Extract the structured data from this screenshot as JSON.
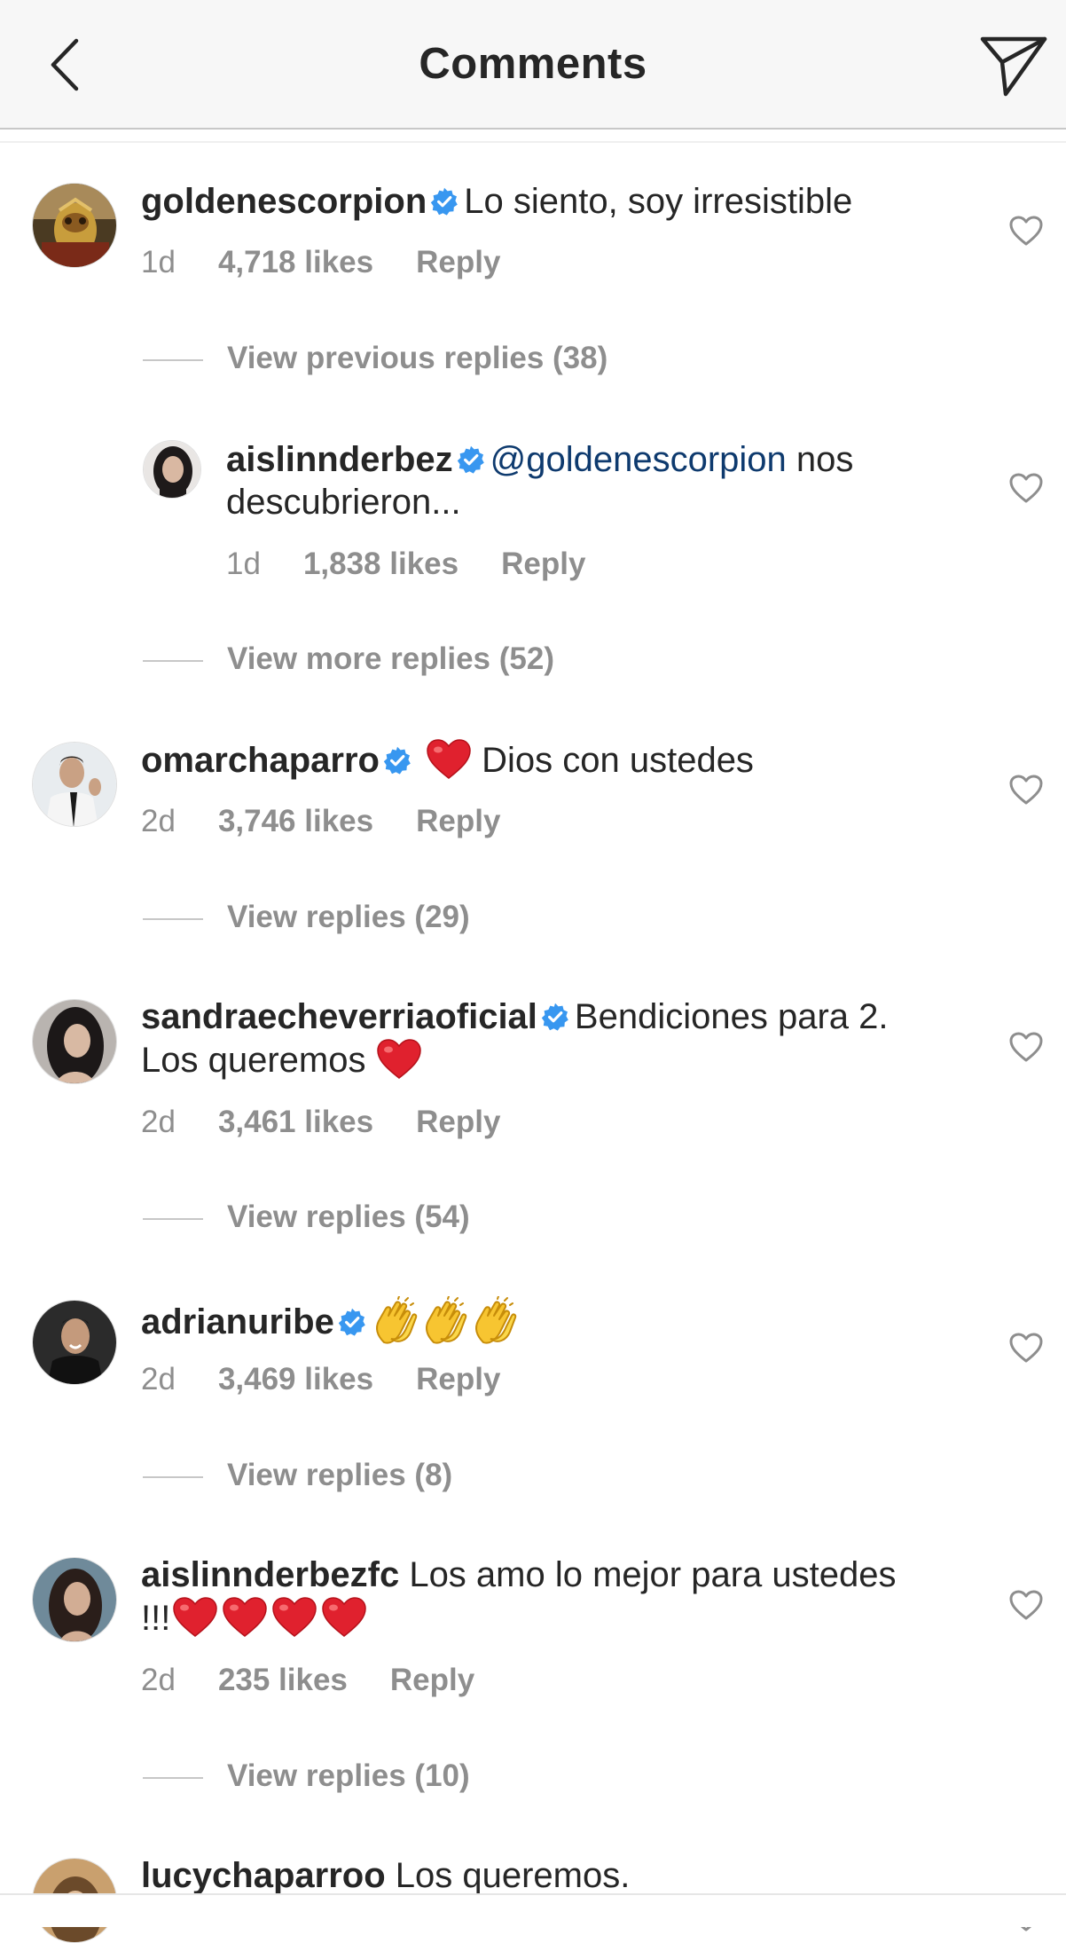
{
  "header": {
    "title": "Comments"
  },
  "comments": [
    {
      "username": "goldenescorpion",
      "verified": true,
      "text": "Lo siento, soy irresistible",
      "time": "1d",
      "likes": "4,718 likes",
      "reply": "Reply"
    },
    {
      "username": "aislinnderbez",
      "verified": true,
      "mention": "@goldenescorpion",
      "text_line1": " nos",
      "text_line2": "descubrieron...",
      "time": "1d",
      "likes": "1,838 likes",
      "reply": "Reply"
    },
    {
      "username": "omarchaparro",
      "verified": true,
      "text": " Dios con ustedes",
      "time": "2d",
      "likes": "3,746 likes",
      "reply": "Reply"
    },
    {
      "username": "sandraecheverriaoficial",
      "verified": true,
      "text_line1": "Bendiciones para 2.",
      "text_line2": "Los queremos ",
      "time": "2d",
      "likes": "3,461 likes",
      "reply": "Reply"
    },
    {
      "username": "adrianuribe",
      "verified": true,
      "time": "2d",
      "likes": "3,469 likes",
      "reply": "Reply"
    },
    {
      "username": "aislinnderbezfc",
      "verified": false,
      "text_line1": " Los amo lo mejor para ustedes",
      "text_line2": "!!!",
      "time": "2d",
      "likes": "235 likes",
      "reply": "Reply"
    },
    {
      "username": "lucychaparroo",
      "verified": false,
      "text": " Los queremos."
    }
  ],
  "reply_links": {
    "previous": "View previous replies (38)",
    "more": "View more replies (52)",
    "omar": "View replies (29)",
    "sandra": "View replies (54)",
    "adrian": "View replies (8)",
    "fc": "View replies (10)"
  },
  "icons": {
    "back": "chevron-left-icon",
    "send": "paper-plane-icon",
    "like": "heart-outline-icon",
    "verified": "verified-badge-icon"
  },
  "colors": {
    "text": "#262626",
    "secondary": "#8e8e8e",
    "verified": "#3897f0",
    "mention": "#0e3a6e",
    "heart": "#e0212e"
  }
}
